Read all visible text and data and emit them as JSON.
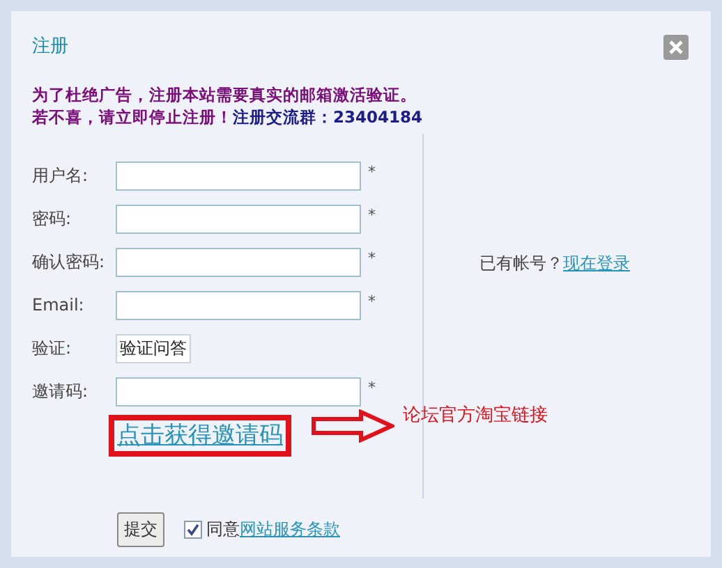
{
  "dialog": {
    "title": "注册"
  },
  "notice": [
    {
      "text": "为了杜绝广告，注册本站需要真实的邮箱激活验证。",
      "color": "#7a0f7a"
    },
    {
      "text": "若不喜，请立即停止注册！",
      "color": "#7a0f7a"
    },
    {
      "text": "注册交流群：23404184",
      "color": "#1c1c8c"
    }
  ],
  "fields": [
    {
      "label": "用户名:",
      "kind": "input",
      "required": true
    },
    {
      "label": "密码:",
      "kind": "input",
      "required": true
    },
    {
      "label": "确认密码:",
      "kind": "input",
      "required": true
    },
    {
      "label": "Email:",
      "kind": "input",
      "required": true
    },
    {
      "label": "验证:",
      "kind": "captcha",
      "value": "验证问答",
      "required": false
    },
    {
      "label": "邀请码:",
      "kind": "input",
      "required": true
    }
  ],
  "asterisk": "*",
  "invite_link": "点击获得邀请码",
  "annotation": "论坛官方淘宝链接",
  "login": {
    "prompt": "已有帐号？",
    "link": "现在登录"
  },
  "submit": "提交",
  "agree": {
    "checked": true,
    "text": "同意",
    "link": "网站服务条款"
  }
}
